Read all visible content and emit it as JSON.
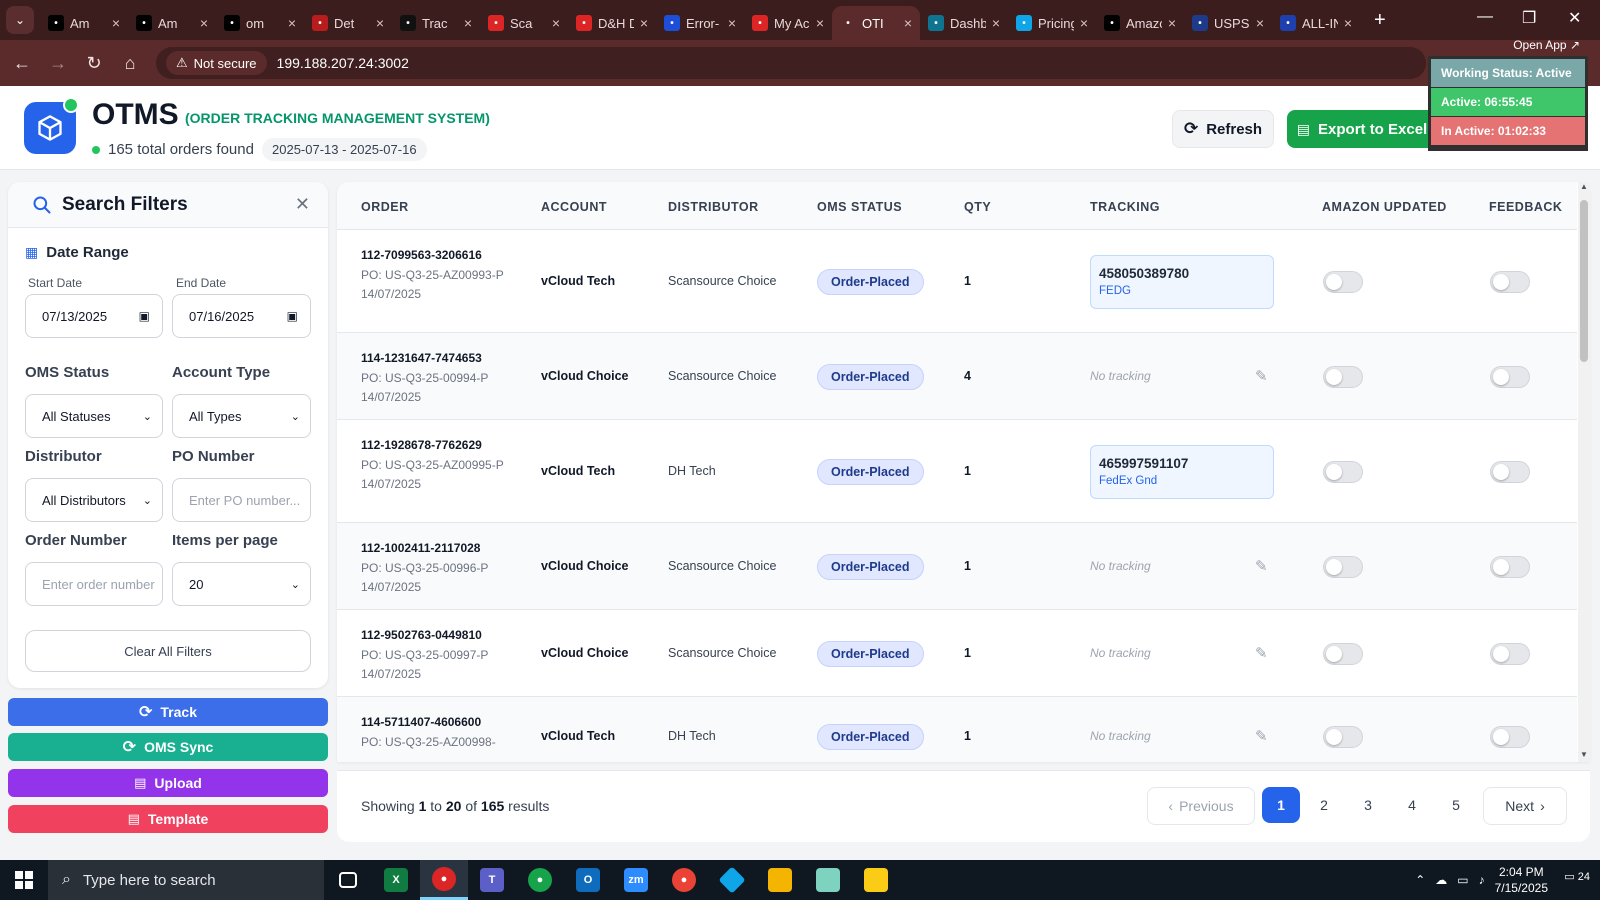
{
  "browser": {
    "tabs": [
      {
        "label": "Am",
        "icon": "amazon-icon",
        "color": "#000000"
      },
      {
        "label": "Am",
        "icon": "amazon-icon",
        "color": "#000000"
      },
      {
        "label": "om",
        "icon": "triangle-icon",
        "color": "#000000"
      },
      {
        "label": "Det",
        "icon": "flag-icon",
        "color": "#b91c1c"
      },
      {
        "label": "Trac",
        "icon": "tracking-icon",
        "color": "#111111"
      },
      {
        "label": "Sca",
        "icon": "scansource-icon",
        "color": "#dc2626"
      },
      {
        "label": "D&H Di",
        "icon": "dh-icon",
        "color": "#dc2626"
      },
      {
        "label": "Error- E",
        "icon": "ec-icon",
        "color": "#1d4ed8"
      },
      {
        "label": "My Acc",
        "icon": "account-icon",
        "color": "#dc2626"
      },
      {
        "label": "OTI",
        "icon": "otms-icon",
        "color": "#5b2b2b",
        "active": true
      },
      {
        "label": "Dashbo",
        "icon": "dashboard-icon",
        "color": "#0e7490"
      },
      {
        "label": "Pricing",
        "icon": "dollar-icon",
        "color": "#0ea5e9"
      },
      {
        "label": "Amazor",
        "icon": "amazon-icon",
        "color": "#000000"
      },
      {
        "label": "USPS.co",
        "icon": "usps-icon",
        "color": "#1e3a8a"
      },
      {
        "label": "ALL-IN-",
        "icon": "t7-icon",
        "color": "#1e40af"
      }
    ],
    "security": "Not secure",
    "url": "199.188.207.24:3002",
    "open_app": "Open App"
  },
  "working_status": {
    "title": "Working Status: Active",
    "active": "Active: 06:55:45",
    "inactive": "In Active: 01:02:33"
  },
  "header": {
    "title": "OTMS",
    "subtitle": "(ORDER TRACKING MANAGEMENT SYSTEM)",
    "order_count": "165 total orders found",
    "date_range": "2025-07-13 - 2025-07-16",
    "refresh_label": "Refresh",
    "export_label": "Export to Excel"
  },
  "filters": {
    "title": "Search Filters",
    "date_range_label": "Date Range",
    "start_date_label": "Start Date",
    "start_date": "07/13/2025",
    "end_date_label": "End Date",
    "end_date": "07/16/2025",
    "oms_status_label": "OMS Status",
    "oms_status_value": "All Statuses",
    "account_type_label": "Account Type",
    "account_type_value": "All Types",
    "distributor_label": "Distributor",
    "distributor_value": "All Distributors",
    "po_number_label": "PO Number",
    "po_number_placeholder": "Enter PO number...",
    "order_number_label": "Order Number",
    "order_number_placeholder": "Enter order number",
    "items_per_page_label": "Items per page",
    "items_per_page_value": "20",
    "clear_label": "Clear All Filters"
  },
  "actions": {
    "track": "Track",
    "oms_sync": "OMS Sync",
    "upload": "Upload",
    "template": "Template"
  },
  "table": {
    "headers": {
      "order": "ORDER",
      "account": "ACCOUNT",
      "distributor": "DISTRIBUTOR",
      "oms_status": "OMS STATUS",
      "qty": "QTY",
      "tracking": "TRACKING",
      "amazon_updated": "AMAZON UPDATED",
      "feedback": "FEEDBACK"
    },
    "rows": [
      {
        "order": "112-7099563-3206616",
        "po": "PO: US-Q3-25-AZ00993-P",
        "date": "14/07/2025",
        "account": "vCloud Tech",
        "distributor": "Scansource Choice",
        "status": "Order-Placed",
        "qty": "1",
        "tracking": "458050389780",
        "carrier": "FEDG"
      },
      {
        "order": "114-1231647-7474653",
        "po": "PO: US-Q3-25-00994-P",
        "date": "14/07/2025",
        "account": "vCloud Choice",
        "distributor": "Scansource Choice",
        "status": "Order-Placed",
        "qty": "4",
        "no_tracking": "No tracking"
      },
      {
        "order": "112-1928678-7762629",
        "po": "PO: US-Q3-25-AZ00995-P",
        "date": "14/07/2025",
        "account": "vCloud Tech",
        "distributor": "DH Tech",
        "status": "Order-Placed",
        "qty": "1",
        "tracking": "465997591107",
        "carrier": "FedEx Gnd"
      },
      {
        "order": "112-1002411-2117028",
        "po": "PO: US-Q3-25-00996-P",
        "date": "14/07/2025",
        "account": "vCloud Choice",
        "distributor": "Scansource Choice",
        "status": "Order-Placed",
        "qty": "1",
        "no_tracking": "No tracking"
      },
      {
        "order": "112-9502763-0449810",
        "po": "PO: US-Q3-25-00997-P",
        "date": "14/07/2025",
        "account": "vCloud Choice",
        "distributor": "Scansource Choice",
        "status": "Order-Placed",
        "qty": "1",
        "no_tracking": "No tracking"
      },
      {
        "order": "114-5711407-4606600",
        "po": "PO: US-Q3-25-AZ00998-",
        "date": "",
        "account": "vCloud Tech",
        "distributor": "DH Tech",
        "status": "Order-Placed",
        "qty": "1",
        "no_tracking": "No tracking"
      }
    ]
  },
  "pagination": {
    "showing_prefix": "Showing",
    "from": "1",
    "to_word": "to",
    "to": "20",
    "of_word": "of",
    "total": "165",
    "suffix": "results",
    "previous": "Previous",
    "next": "Next",
    "pages": [
      "1",
      "2",
      "3",
      "4",
      "5"
    ]
  },
  "taskbar": {
    "search_placeholder": "Type here to search",
    "time": "2:04 PM",
    "date": "7/15/2025",
    "notifications": "24"
  }
}
